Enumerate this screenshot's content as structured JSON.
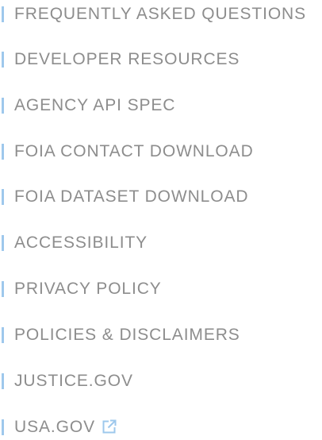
{
  "footer_nav": {
    "items": [
      {
        "label": "FREQUENTLY ASKED QUESTIONS"
      },
      {
        "label": "DEVELOPER RESOURCES"
      },
      {
        "label": "AGENCY API SPEC"
      },
      {
        "label": "FOIA CONTACT DOWNLOAD"
      },
      {
        "label": "FOIA DATASET DOWNLOAD"
      },
      {
        "label": "ACCESSIBILITY"
      },
      {
        "label": "PRIVACY POLICY"
      },
      {
        "label": "POLICIES & DISCLAIMERS"
      },
      {
        "label": "JUSTICE.GOV"
      },
      {
        "label": "USA.GOV",
        "icon": "external-link-icon"
      }
    ]
  },
  "colors": {
    "text": "#8d8d8d",
    "accent_bar": "#9ec8ec",
    "external_icon": "#9ec8ec",
    "background": "#ffffff"
  }
}
